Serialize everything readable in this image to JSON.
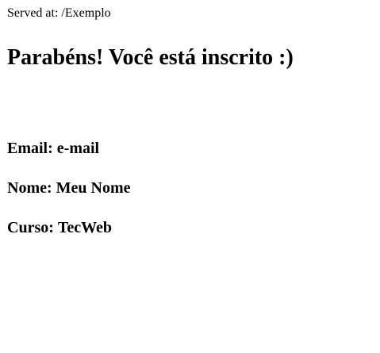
{
  "served": {
    "label": "Served at:",
    "path": "/Exemplo"
  },
  "title": "Parabéns! Você está inscrito :)",
  "fields": [
    {
      "label": "Email:",
      "value": "e-mail"
    },
    {
      "label": "Nome:",
      "value": "Meu Nome"
    },
    {
      "label": "Curso:",
      "value": "TecWeb"
    }
  ]
}
